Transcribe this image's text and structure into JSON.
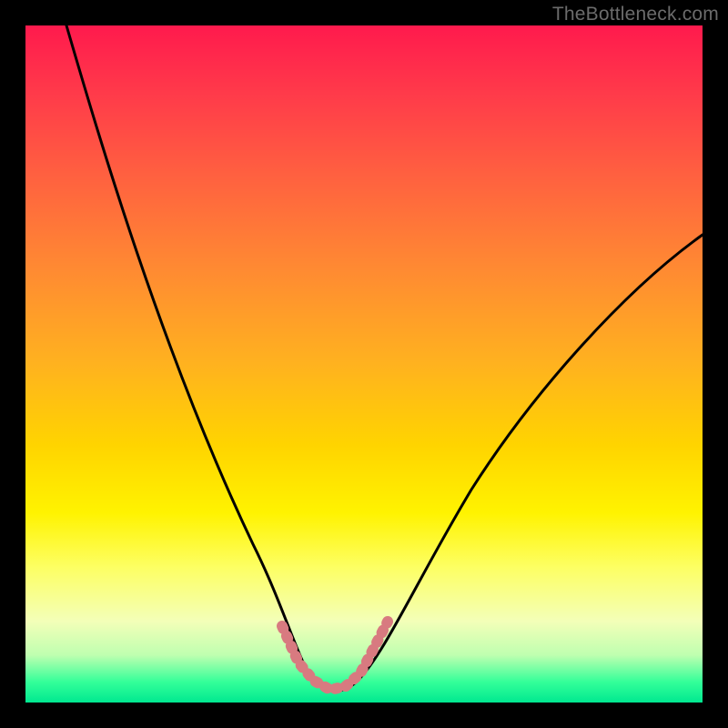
{
  "watermark": "TheBottleneck.com",
  "chart_data": {
    "type": "line",
    "title": "",
    "xlabel": "",
    "ylabel": "",
    "xlim": [
      0,
      100
    ],
    "ylim": [
      0,
      100
    ],
    "series": [
      {
        "name": "bottleneck-curve",
        "x": [
          6,
          10,
          15,
          20,
          25,
          30,
          35,
          38,
          40,
          42,
          44,
          46,
          48,
          50,
          55,
          60,
          65,
          70,
          75,
          80,
          85,
          90,
          95,
          100
        ],
        "y": [
          100,
          90,
          78,
          65,
          52,
          38,
          22,
          12,
          6,
          3,
          2,
          2,
          2,
          3,
          8,
          16,
          24,
          31,
          38,
          44,
          50,
          55,
          59,
          63
        ]
      }
    ],
    "highlight": {
      "name": "optimum-band",
      "color": "#d87a80",
      "x": [
        38,
        40,
        42,
        44,
        46,
        48,
        50
      ],
      "y": [
        12,
        6,
        3,
        2,
        2,
        3,
        8
      ]
    },
    "gradient_stops": [
      {
        "pos": 0.0,
        "color": "#ff1a4d"
      },
      {
        "pos": 0.5,
        "color": "#ffd400"
      },
      {
        "pos": 0.8,
        "color": "#fdff63"
      },
      {
        "pos": 1.0,
        "color": "#00e890"
      }
    ]
  }
}
